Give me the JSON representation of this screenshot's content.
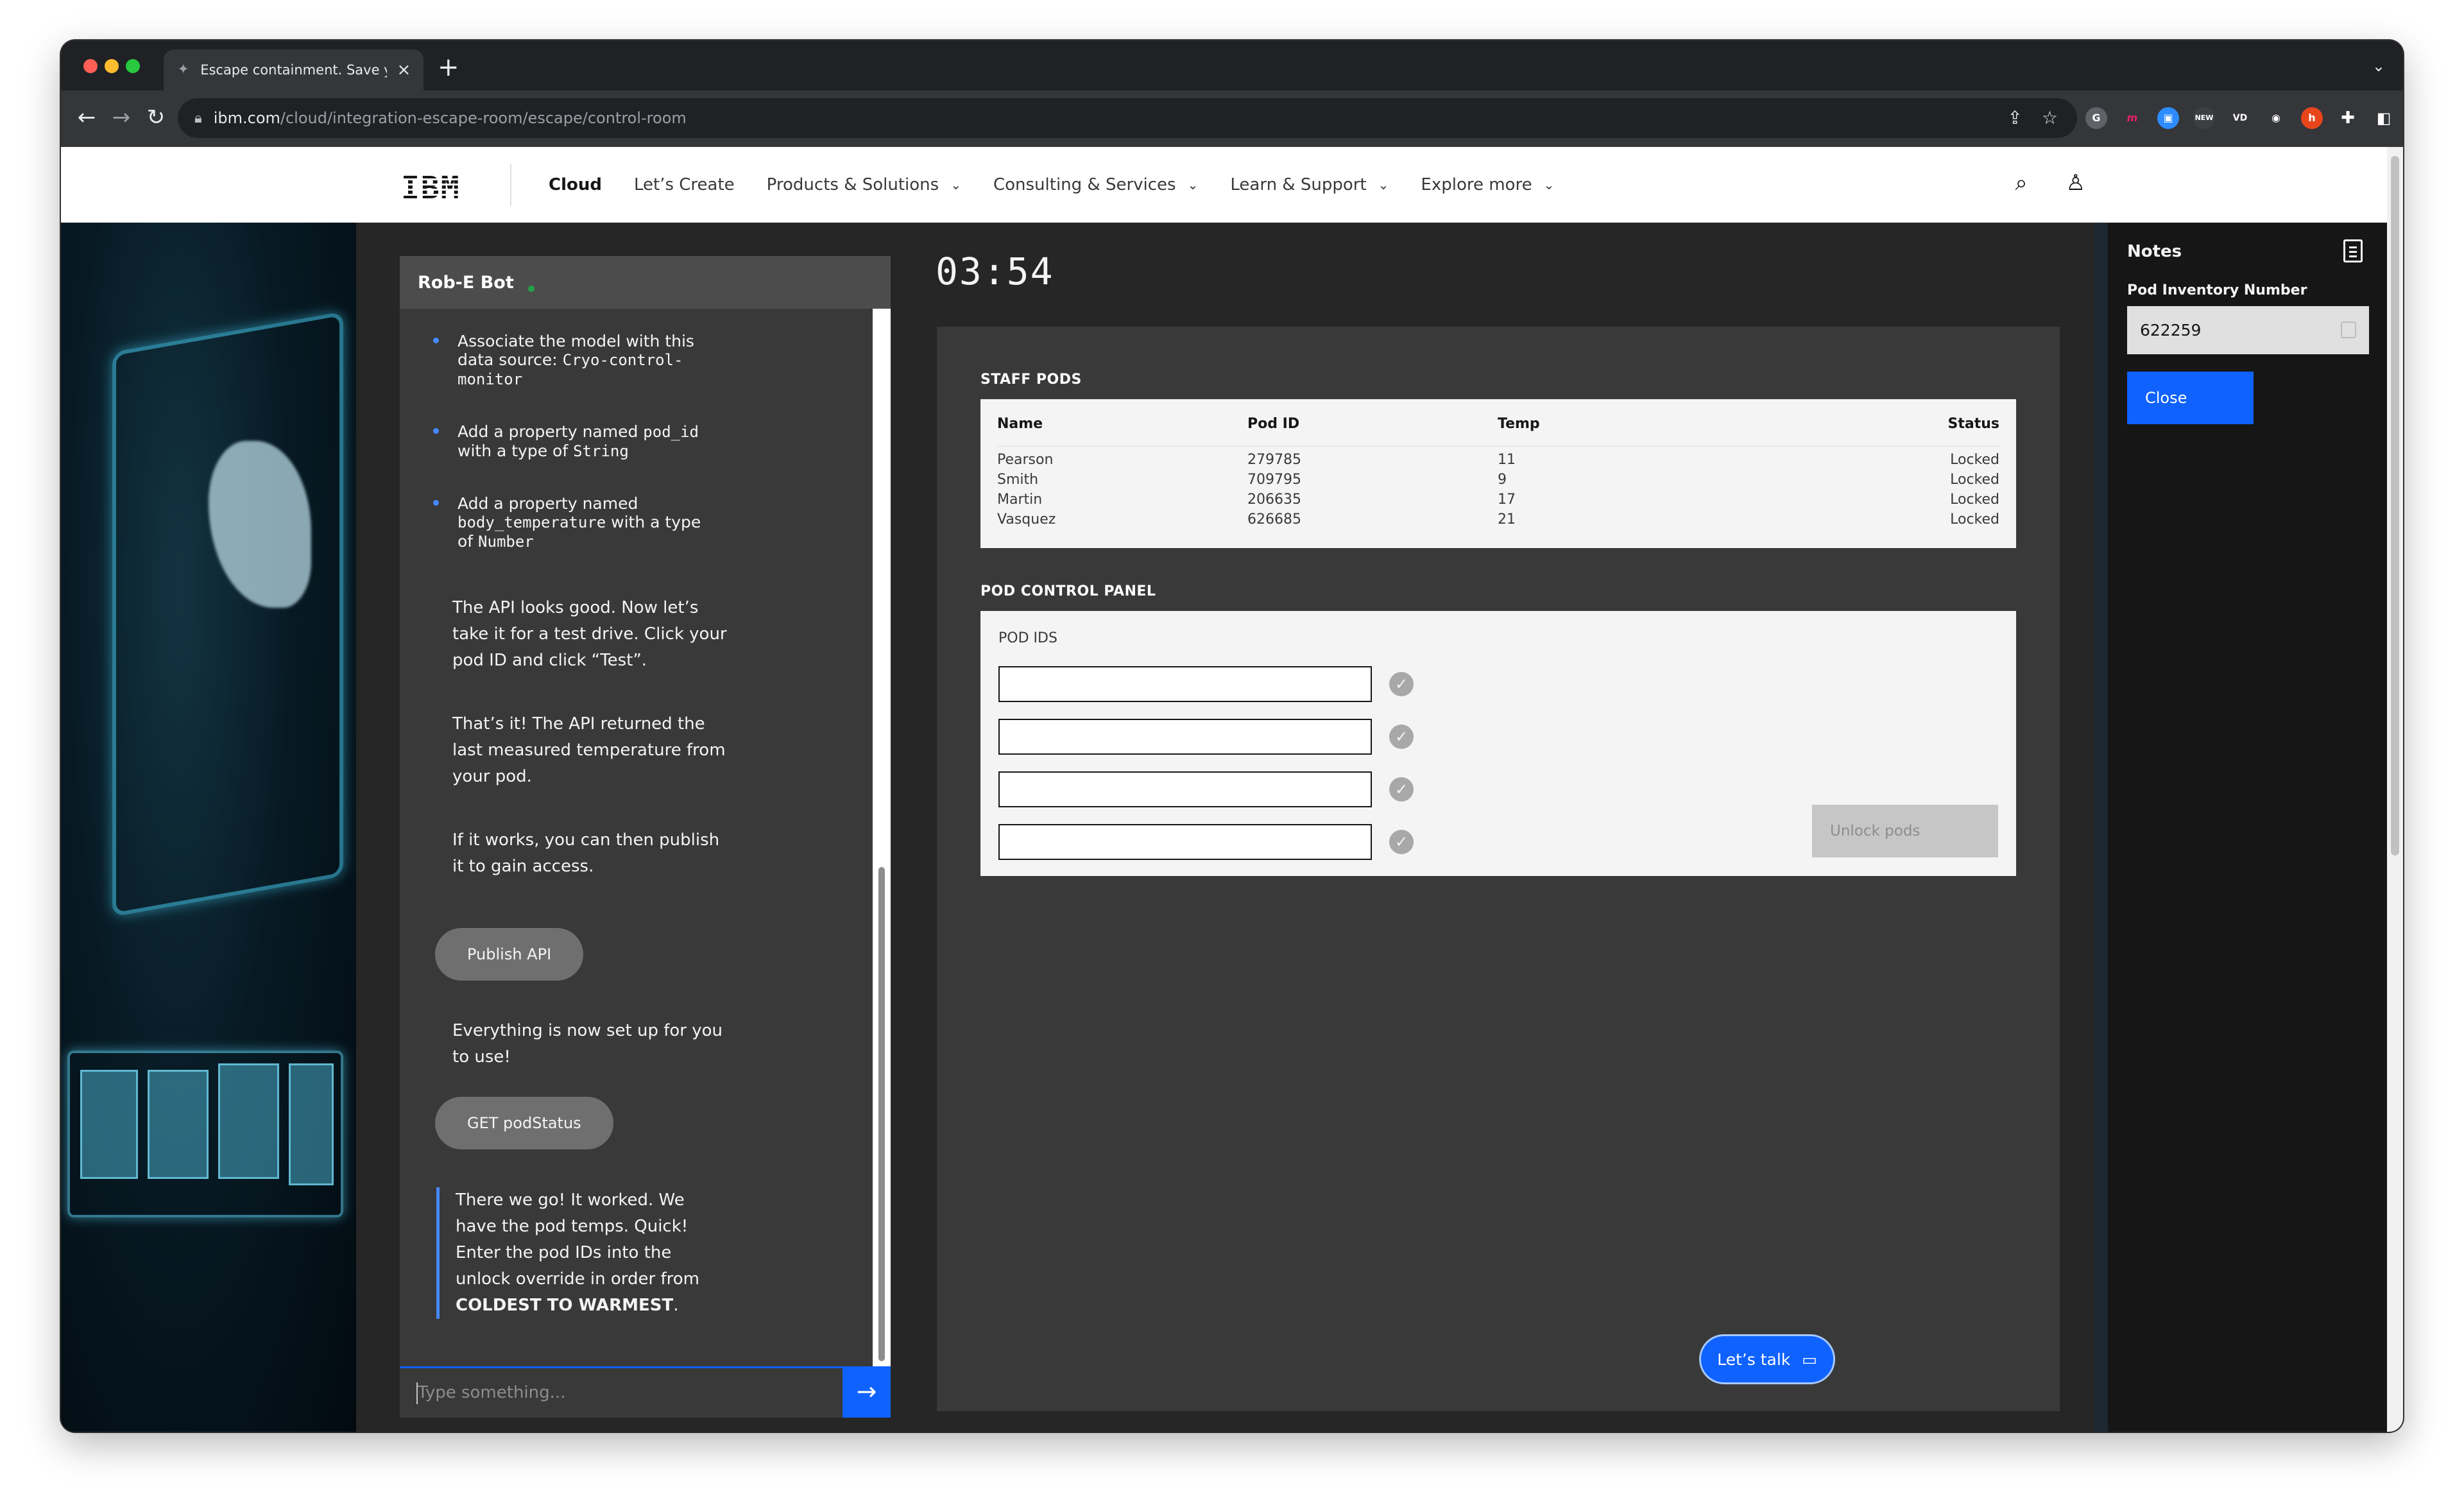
{
  "browser": {
    "tab_title": "Escape containment. Save you",
    "tab_icon": "ibm-favicon",
    "url_host": "ibm.com",
    "url_path": "/cloud/integration-escape-room/escape/control-room"
  },
  "nav": {
    "logo": "IBM",
    "items": [
      {
        "label": "Cloud",
        "active": true,
        "dropdown": false
      },
      {
        "label": "Let’s Create",
        "active": false,
        "dropdown": false
      },
      {
        "label": "Products & Solutions",
        "active": false,
        "dropdown": true
      },
      {
        "label": "Consulting & Services",
        "active": false,
        "dropdown": true
      },
      {
        "label": "Learn & Support",
        "active": false,
        "dropdown": true
      },
      {
        "label": "Explore more",
        "active": false,
        "dropdown": true
      }
    ]
  },
  "chat": {
    "bot_name": "Rob-E Bot",
    "bullets": [
      {
        "text": "Associate the model with this data source: ",
        "code": "Cryo-control-monitor",
        "suffix": ""
      },
      {
        "text": "Add a property named ",
        "code": "pod_id",
        "suffix": " with a type of ",
        "code2": "String"
      },
      {
        "text": "Add a property named ",
        "code": "body_temperature",
        "suffix": " with a type of ",
        "code2": "Number"
      }
    ],
    "msg1": "The API looks good. Now let’s take it for a test drive. Click your pod ID and click “Test”.",
    "msg2": "That’s it! The API returned the last measured temperature from your pod.",
    "msg3": "If it works, you can then publish it to gain access.",
    "publish_button": "Publish API",
    "msg4": "Everything is now set up for you to use!",
    "get_button": "GET podStatus",
    "msg5_prefix": "There we go! It worked. We have the pod temps. Quick! Enter the pod IDs into the unlock override in order from ",
    "msg5_bold": "COLDEST TO WARMEST",
    "msg5_suffix": ".",
    "input_placeholder": "Type something...",
    "send_icon": "arrow-right-icon"
  },
  "timer": "03:54",
  "staff_pods": {
    "title": "STAFF PODS",
    "headers": [
      "Name",
      "Pod ID",
      "Temp",
      "Status"
    ],
    "rows": [
      {
        "name": "Pearson",
        "pod_id": "279785",
        "temp": "11",
        "status": "Locked"
      },
      {
        "name": "Smith",
        "pod_id": "709795",
        "temp": "9",
        "status": "Locked"
      },
      {
        "name": "Martin",
        "pod_id": "206635",
        "temp": "17",
        "status": "Locked"
      },
      {
        "name": "Vasquez",
        "pod_id": "626685",
        "temp": "21",
        "status": "Locked"
      }
    ]
  },
  "control_panel": {
    "title": "POD CONTROL PANEL",
    "label": "POD IDS",
    "inputs": [
      "",
      "",
      "",
      ""
    ],
    "unlock_button": "Unlock pods"
  },
  "lets_talk": "Let’s talk",
  "notes": {
    "title": "Notes",
    "field_label": "Pod Inventory Number",
    "field_value": "622259",
    "close_button": "Close"
  },
  "colors": {
    "accent": "#0f62fe",
    "panel_bg": "#393939",
    "page_bg": "#262626"
  }
}
